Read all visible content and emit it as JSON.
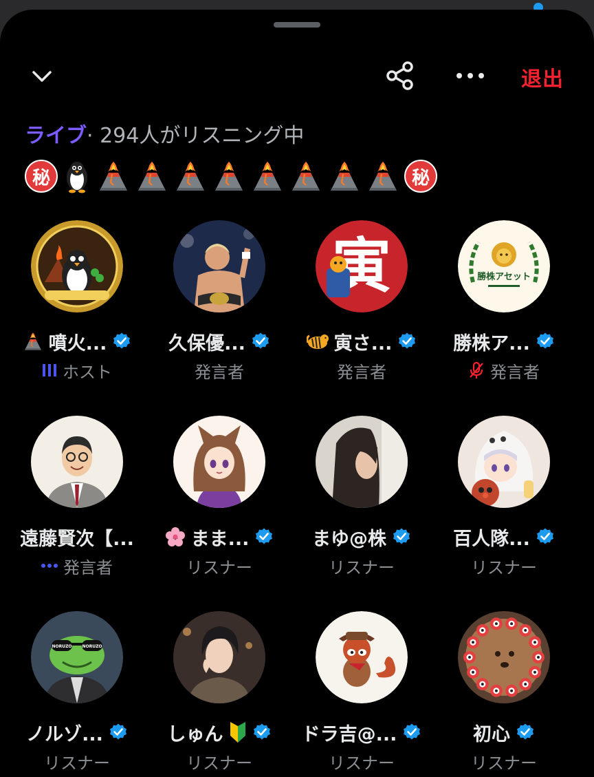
{
  "header": {
    "leave_label": "退出"
  },
  "status": {
    "live_label": "ライブ",
    "listening_text": "· 294人がリスニング中"
  },
  "emoji_row": [
    "secret-icon",
    "penguin-icon",
    "volcano-icon",
    "volcano-icon",
    "volcano-icon",
    "volcano-icon",
    "volcano-icon",
    "volcano-icon",
    "volcano-icon",
    "volcano-icon",
    "secret-icon"
  ],
  "secret_glyph": "秘",
  "participants": [
    {
      "name": "噴火...",
      "prefix": "volcano",
      "verified": true,
      "role": "ホスト",
      "role_icon": "audio-bars",
      "avatar": "penguin"
    },
    {
      "name": "久保優...",
      "prefix": "",
      "verified": true,
      "role": "発言者",
      "role_icon": "",
      "avatar": "boxer"
    },
    {
      "name": "寅さ...",
      "prefix": "tiger",
      "verified": true,
      "role": "発言者",
      "role_icon": "",
      "avatar": "tora",
      "avatar_text": "寅"
    },
    {
      "name": "勝株ア...",
      "prefix": "",
      "verified": true,
      "role": "発言者",
      "role_icon": "mic-off",
      "avatar": "lion",
      "avatar_text": "勝株アセット"
    },
    {
      "name": "遠藤賢次【...",
      "prefix": "",
      "verified": false,
      "role": "発言者",
      "role_icon": "dots",
      "avatar": "man"
    },
    {
      "name": "まま...",
      "prefix": "blossom",
      "verified": true,
      "role": "リスナー",
      "role_icon": "",
      "avatar": "catgirl"
    },
    {
      "name": "まゆ@株",
      "prefix": "",
      "verified": true,
      "role": "リスナー",
      "role_icon": "",
      "avatar": "woman"
    },
    {
      "name": "百人隊...",
      "prefix": "",
      "verified": true,
      "role": "リスナー",
      "role_icon": "",
      "avatar": "ghostgirl"
    },
    {
      "name": "ノルゾ...",
      "prefix": "",
      "verified": true,
      "role": "リスナー",
      "role_icon": "",
      "avatar": "frog",
      "avatar_text": "NORUZO"
    },
    {
      "name": "しゅん",
      "prefix": "",
      "suffix": "beginner",
      "verified": true,
      "role": "リスナー",
      "role_icon": "",
      "avatar": "animeboy"
    },
    {
      "name": "ドラ吉@...",
      "prefix": "",
      "verified": true,
      "role": "リスナー",
      "role_icon": "",
      "avatar": "redpanda"
    },
    {
      "name": "初心",
      "prefix": "",
      "verified": true,
      "role": "リスナー",
      "role_icon": "",
      "avatar": "dog"
    }
  ],
  "colors": {
    "live": "#7c5cff",
    "leave": "#f4212e",
    "verified": "#1d9bf0",
    "role": "#8b8f94",
    "host_bars": "#4b55f0",
    "mic_off": "#f4212e"
  }
}
